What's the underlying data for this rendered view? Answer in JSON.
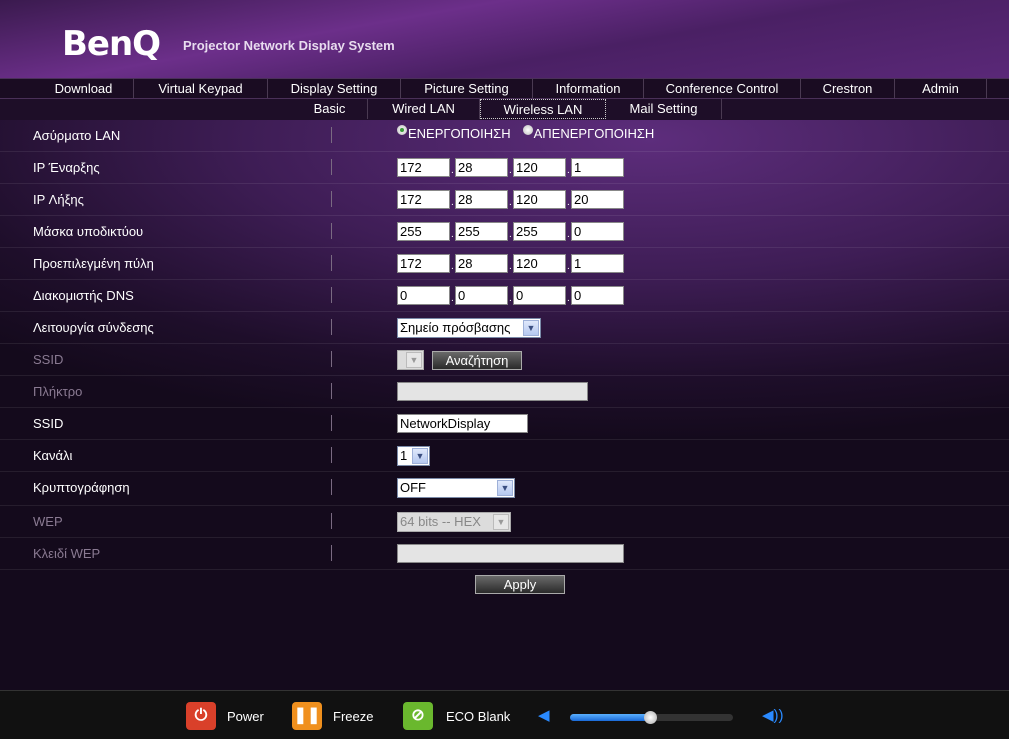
{
  "header": {
    "logo": "BenQ",
    "title": "Projector Network Display System"
  },
  "nav": [
    {
      "label": "Download",
      "w": 100
    },
    {
      "label": "Virtual Keypad",
      "w": 134
    },
    {
      "label": "Display Setting",
      "w": 133
    },
    {
      "label": "Picture Setting",
      "w": 132
    },
    {
      "label": "Information",
      "w": 111
    },
    {
      "label": "Conference Control",
      "w": 157
    },
    {
      "label": "Crestron",
      "w": 94
    },
    {
      "label": "Admin",
      "w": 92
    }
  ],
  "subnav": [
    {
      "label": "Basic",
      "w": 76,
      "active": false
    },
    {
      "label": "Wired LAN",
      "w": 112,
      "active": false
    },
    {
      "label": "Wireless LAN",
      "w": 126,
      "active": true
    },
    {
      "label": "Mail Setting",
      "w": 116,
      "active": false
    }
  ],
  "form": {
    "wireless_lan": {
      "label": "Ασύρματο LAN",
      "on": "ΕΝΕΡΓΟΠΟΙΗΣΗ",
      "off": "ΑΠΕΝΕΡΓΟΠΟΙΗΣΗ",
      "selected": "on"
    },
    "ip_rows": [
      {
        "label": "IP Έναρξης",
        "values": [
          "172",
          "28",
          "120",
          "1"
        ]
      },
      {
        "label": "IP Λήξης",
        "values": [
          "172",
          "28",
          "120",
          "20"
        ]
      },
      {
        "label": "Μάσκα υποδικτύου",
        "values": [
          "255",
          "255",
          "255",
          "0"
        ]
      },
      {
        "label": "Προεπιλεγμένη πύλη",
        "values": [
          "172",
          "28",
          "120",
          "1"
        ]
      },
      {
        "label": "Διακομιστής DNS",
        "values": [
          "0",
          "0",
          "0",
          "0"
        ]
      }
    ],
    "connection_mode": {
      "label": "Λειτουργία σύνδεσης",
      "value": "Σημείο πρόσβασης"
    },
    "ssid_search": {
      "label": "SSID",
      "value": "",
      "button": "Αναζήτηση",
      "disabled": true
    },
    "key": {
      "label": "Πλήκτρο",
      "value": "",
      "disabled": true
    },
    "ssid": {
      "label": "SSID",
      "value": "NetworkDisplay"
    },
    "channel": {
      "label": "Κανάλι",
      "value": "1"
    },
    "encryption": {
      "label": "Κρυπτογράφηση",
      "value": "OFF"
    },
    "wep": {
      "label": "WEP",
      "value": "64 bits -- HEX",
      "disabled": true
    },
    "wep_key": {
      "label": "Κλειδί WEP",
      "value": "",
      "disabled": true
    },
    "apply": "Apply"
  },
  "footer": {
    "power": "Power",
    "freeze": "Freeze",
    "eco_blank": "ECO Blank",
    "volume_fraction": 0.49,
    "colors": {
      "power": "#d9402a",
      "freeze": "#f0901e",
      "eco": "#6ab82e",
      "volume": "#2a8aff"
    }
  }
}
